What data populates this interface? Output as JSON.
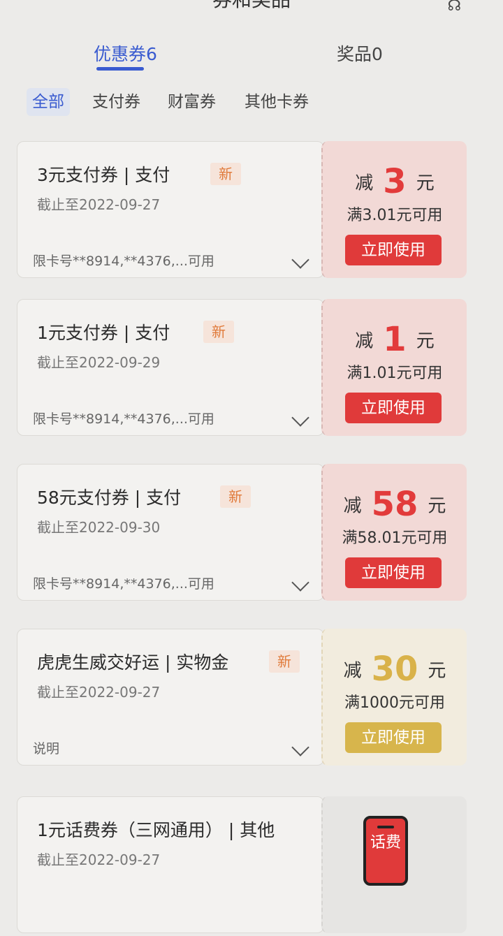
{
  "header": {
    "title": "券和奖品",
    "right_icon": "headset-icon"
  },
  "tabs": [
    {
      "label": "优惠券6",
      "active": true
    },
    {
      "label": "奖品0",
      "active": false
    }
  ],
  "filters": [
    {
      "label": "全部",
      "active": true
    },
    {
      "label": "支付券",
      "active": false
    },
    {
      "label": "财富券",
      "active": false
    },
    {
      "label": "其他卡券",
      "active": false
    }
  ],
  "coupons": [
    {
      "name": "3元支付券 | 支付",
      "badge": "新",
      "expiry": "截止至2022-09-27",
      "limit": "限卡号**8914,**4376,...可用",
      "prefix": "减",
      "amount": "3",
      "unit": "元",
      "condition": "满3.01元可用",
      "button": "立即使用",
      "style": "red"
    },
    {
      "name": "1元支付券 | 支付",
      "badge": "新",
      "expiry": "截止至2022-09-29",
      "limit": "限卡号**8914,**4376,...可用",
      "prefix": "减",
      "amount": "1",
      "unit": "元",
      "condition": "满1.01元可用",
      "button": "立即使用",
      "style": "red"
    },
    {
      "name": "58元支付券 | 支付",
      "badge": "新",
      "expiry": "截止至2022-09-30",
      "limit": "限卡号**8914,**4376,...可用",
      "prefix": "减",
      "amount": "58",
      "unit": "元",
      "condition": "满58.01元可用",
      "button": "立即使用",
      "style": "red"
    },
    {
      "name": "虎虎生威交好运 | 实物金",
      "badge": "新",
      "expiry": "截止至2022-09-27",
      "limit": "说明",
      "prefix": "减",
      "amount": "30",
      "unit": "元",
      "condition": "满1000元可用",
      "button": "立即使用",
      "style": "gold"
    },
    {
      "name": "1元话费券（三网通用） | 其他",
      "expiry": "截止至2022-09-27",
      "icon_text": "话费",
      "style": "gray"
    }
  ],
  "colors": {
    "accent": "#3a5bd0",
    "red": "#e03a3a",
    "gold": "#d7b54c"
  }
}
